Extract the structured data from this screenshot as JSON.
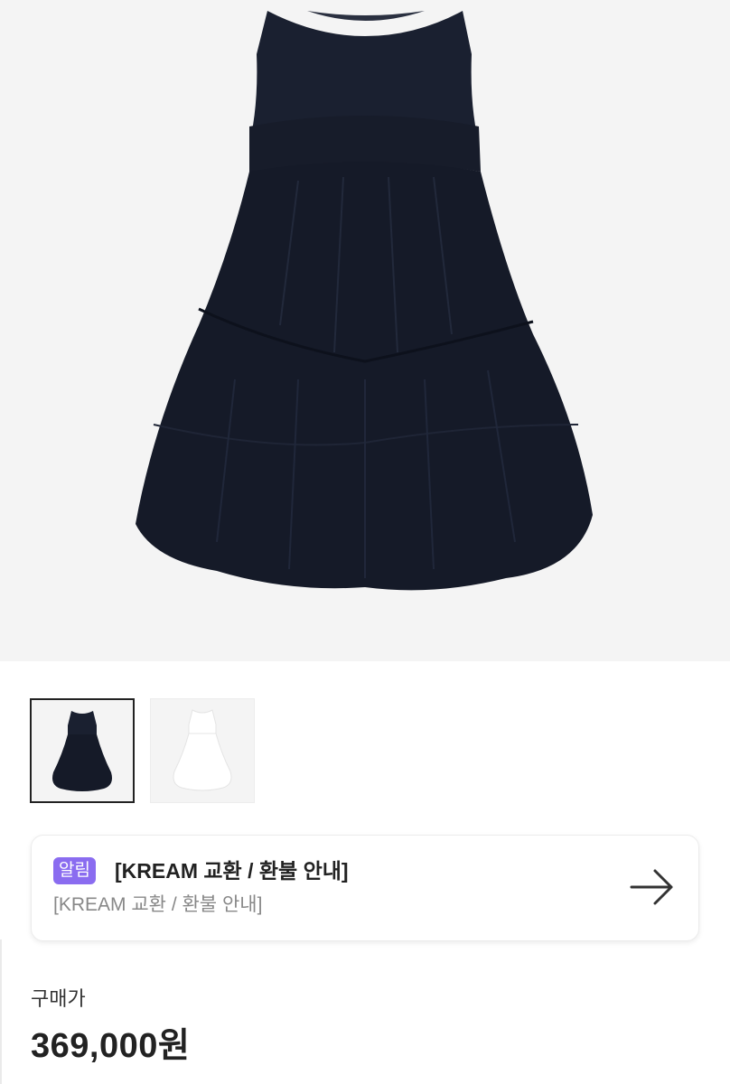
{
  "product": {
    "main_image_icon": "navy-tiered-dress-image",
    "accent_color": "#8a6cf0"
  },
  "thumbnails": [
    {
      "name": "navy-dress-thumbnail",
      "selected": true
    },
    {
      "name": "white-dress-thumbnail",
      "selected": false
    }
  ],
  "notice": {
    "badge": "알림",
    "title": "[KREAM 교환 / 환불 안내]",
    "subtitle": "[KREAM 교환 / 환불 안내]",
    "arrow_icon": "arrow-right-icon"
  },
  "purchase": {
    "label": "구매가",
    "price": "369,000원"
  }
}
